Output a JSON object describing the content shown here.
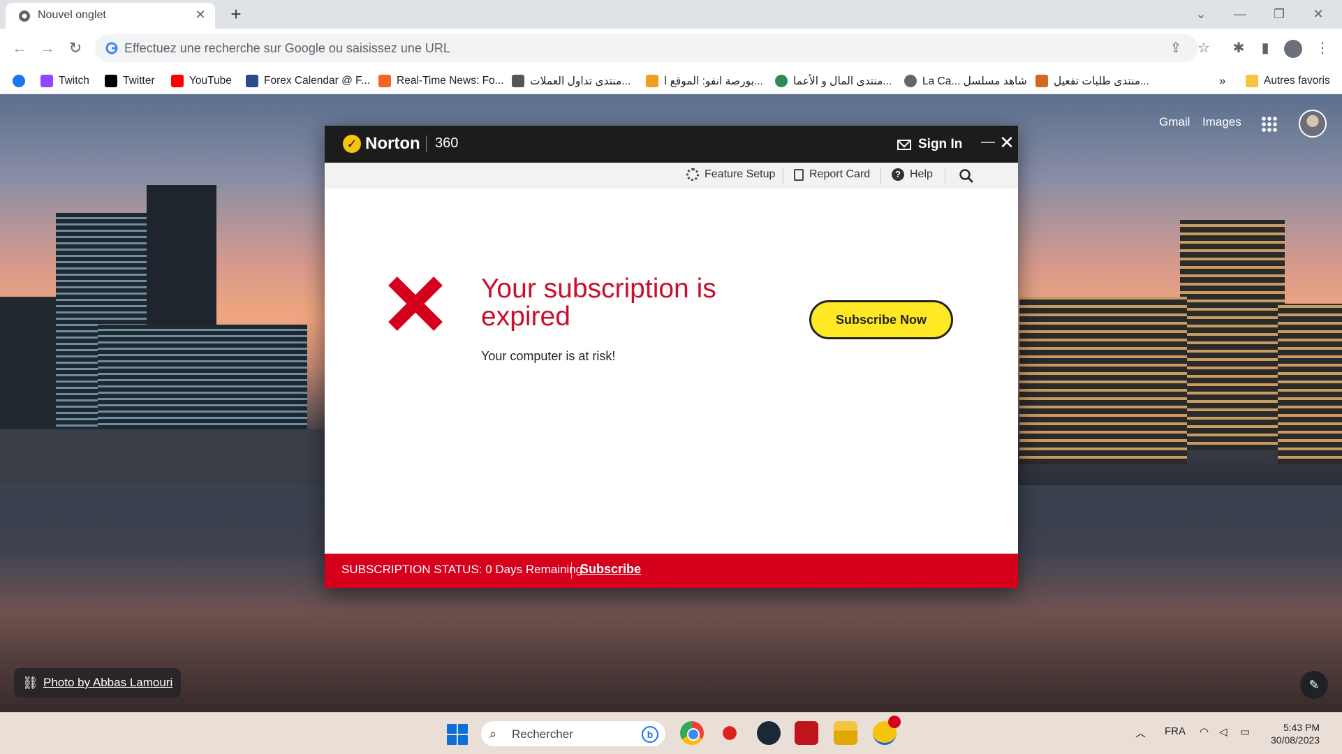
{
  "browser": {
    "tab_title": "Nouvel onglet",
    "tab_close": "✕",
    "new_tab": "+",
    "omnibox_placeholder": "Effectuez une recherche sur Google ou saisissez une URL",
    "bookmarks": [
      {
        "label": "",
        "icon": "facebook-icon",
        "color": "#1877f2"
      },
      {
        "label": "Twitch",
        "icon": "twitch-icon",
        "color": "#9146ff"
      },
      {
        "label": "Twitter",
        "icon": "x-icon",
        "color": "#000000"
      },
      {
        "label": "YouTube",
        "icon": "youtube-icon",
        "color": "#ff0000"
      },
      {
        "label": "Forex Calendar @ F...",
        "icon": "forex-factory-icon",
        "color": "#2b4c8c"
      },
      {
        "label": "Real-Time News: Fo...",
        "icon": "dailyfx-icon",
        "color": "#f26522"
      },
      {
        "label": "منتدى تداول العملات...",
        "icon": "forum-icon",
        "color": "#555555"
      },
      {
        "label": "بورصة انفو: الموقع ا...",
        "icon": "bourse-icon",
        "color": "#f0a020"
      },
      {
        "label": "منتدى المال و الأعما...",
        "icon": "finance-forum-icon",
        "color": "#2e8b57"
      },
      {
        "label": "La Ca... شاهد مسلسل",
        "icon": "globe-icon",
        "color": "#666666"
      },
      {
        "label": "منتدى طلبات تفعيل...",
        "icon": "activation-forum-icon",
        "color": "#d2691e"
      }
    ],
    "bookmarks_overflow": "»",
    "other_bookmarks": "Autres favoris"
  },
  "ntp": {
    "gmail": "Gmail",
    "images": "Images",
    "photo_credit": "Photo by Abbas Lamouri"
  },
  "norton": {
    "brand": "Norton",
    "product": "360",
    "sign_in": "Sign In",
    "menu": {
      "feature_setup": "Feature Setup",
      "report_card": "Report Card",
      "help": "Help"
    },
    "headline": "Your subscription is expired",
    "subtext": "Your computer is at risk!",
    "subscribe_now": "Subscribe Now",
    "status_label": "SUBSCRIPTION STATUS:  0 Days Remaining",
    "status_link": "Subscribe",
    "colors": {
      "accent": "#ffe924",
      "alert": "#d6001c",
      "titlebar": "#1c1c1c"
    }
  },
  "taskbar": {
    "search_placeholder": "Rechercher",
    "language": "FRA",
    "time": "5:43 PM",
    "date": "30/08/2023"
  }
}
